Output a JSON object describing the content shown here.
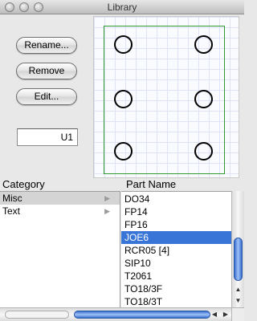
{
  "window": {
    "title": "Library"
  },
  "buttons": {
    "rename": "Rename...",
    "remove": "Remove",
    "edit": "Edit..."
  },
  "reference_field": {
    "value": "U1"
  },
  "columns": {
    "category": "Category",
    "part_name": "Part Name"
  },
  "categories": [
    {
      "label": "Misc",
      "selected": true,
      "arrow": "▶"
    },
    {
      "label": "Text",
      "selected": false,
      "arrow": "▶"
    }
  ],
  "parts": [
    {
      "label": "DO34"
    },
    {
      "label": "FP14"
    },
    {
      "label": "FP16"
    },
    {
      "label": "JOE6",
      "selected": true
    },
    {
      "label": "RCR05 [4]"
    },
    {
      "label": "SIP10"
    },
    {
      "label": "T2061"
    },
    {
      "label": "TO18/3F"
    },
    {
      "label": "TO18/3T"
    }
  ],
  "preview": {
    "outline_color": "#2f9b2f",
    "pads": 6
  },
  "scroll_glyphs": {
    "up": "▲",
    "down": "▼",
    "left": "◀",
    "right": "▶"
  }
}
